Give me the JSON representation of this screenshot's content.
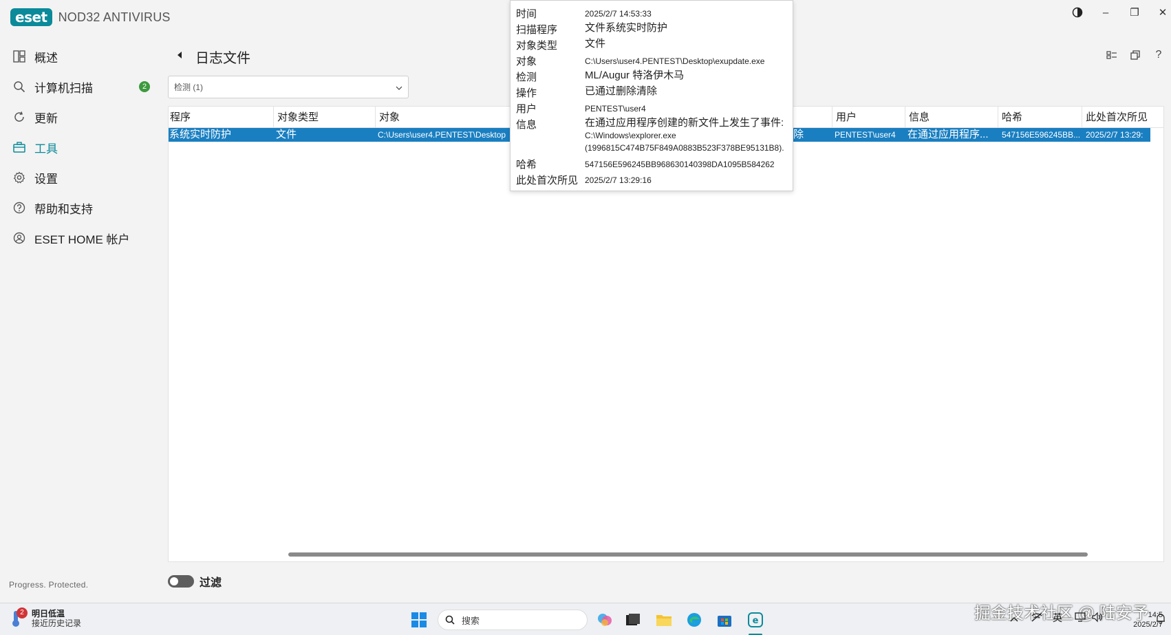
{
  "titlebar": {
    "logo_text": "eset",
    "product": "NOD32 ANTIVIRUS",
    "contrast_icon": "contrast-icon",
    "minimize_label": "–",
    "maximize_label": "❐",
    "close_label": "✕"
  },
  "sidebar": {
    "items": [
      {
        "label": "概述",
        "icon": "overview-icon"
      },
      {
        "label": "计算机扫描",
        "icon": "search-icon",
        "badge": "2"
      },
      {
        "label": "更新",
        "icon": "refresh-icon"
      },
      {
        "label": "工具",
        "icon": "toolbox-icon",
        "active": true
      },
      {
        "label": "设置",
        "icon": "gear-icon"
      },
      {
        "label": "帮助和支持",
        "icon": "help-icon"
      },
      {
        "label": "ESET HOME 帐户",
        "icon": "account-icon"
      }
    ],
    "tagline": "Progress. Protected."
  },
  "main": {
    "title": "日志文件",
    "filter_select": {
      "value": "检测 (1)"
    },
    "header_icons": [
      "view-toggle-icon",
      "restore-icon",
      "help-icon"
    ],
    "help_label": "?"
  },
  "table": {
    "columns": [
      "程序",
      "对象类型",
      "对象",
      "用户",
      "信息",
      "哈希",
      "此处首次所见"
    ],
    "row": {
      "program": "系统实时防护",
      "object_type": "文件",
      "object": "C:\\Users\\user4.PENTEST\\Desktop",
      "action_partial": "除",
      "user": "PENTEST\\user4",
      "info": "在通过应用程序...",
      "hash": "547156E596245BB...",
      "first_seen": "2025/2/7 13:29:"
    }
  },
  "tooltip": {
    "time_k": "时间",
    "time_v": "2025/2/7 14:53:33",
    "scanner_k": "扫描程序",
    "scanner_v": "文件系统实时防护",
    "objtype_k": "对象类型",
    "objtype_v": "文件",
    "object_k": "对象",
    "object_v": "C:\\Users\\user4.PENTEST\\Desktop\\exupdate.exe",
    "detect_k": "检测",
    "detect_v": "ML/Augur 特洛伊木马",
    "action_k": "操作",
    "action_v": "已通过删除清除",
    "user_k": "用户",
    "user_v": "PENTEST\\user4",
    "info_k": "信息",
    "info_v1": "在通过应用程序创建的新文件上发生了事件:",
    "info_v2": "C:\\Windows\\explorer.exe (1996815C474B75F849A0883B523F378BE95131B8).",
    "hash_k": "哈希",
    "hash_v": "547156E596245BB968630140398DA1095B584262",
    "first_k": "此处首次所见",
    "first_v": "2025/2/7 13:29:16"
  },
  "filter_toggle": {
    "label": "过滤",
    "on": false
  },
  "taskbar": {
    "weather_badge": "2",
    "weather_title": "明日低温",
    "weather_sub": "接近历史记录",
    "search_placeholder": "搜索",
    "watermark": "掘金技术社区 @ 陆安予",
    "ime": "英",
    "time": "14:5",
    "date": "2025/2/7"
  },
  "colors": {
    "accent": "#0b8a9a",
    "selection": "#1a7fc1",
    "badge_green": "#3d9a3d"
  }
}
